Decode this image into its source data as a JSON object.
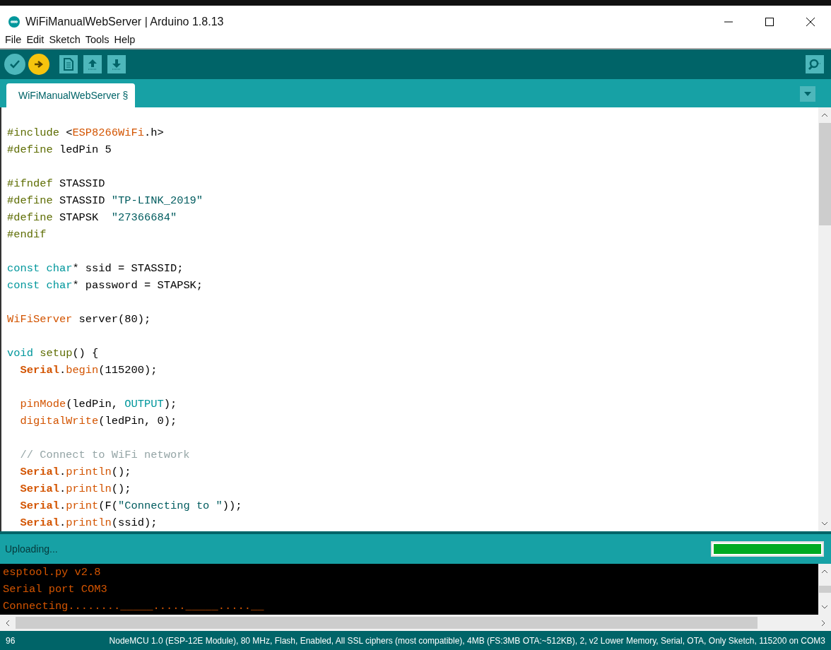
{
  "window": {
    "title": "WiFiManualWebServer | Arduino 1.8.13"
  },
  "menu": [
    "File",
    "Edit",
    "Sketch",
    "Tools",
    "Help"
  ],
  "tabs": [
    {
      "label": "WiFiManualWebServer §",
      "selected": true
    }
  ],
  "code_blocks": [
    {
      "lines": [
        [
          {
            "text": "#include",
            "kind": "directive"
          },
          {
            "text": " <",
            "kind": "plain"
          },
          {
            "text": "ESP8266WiFi",
            "kind": "type"
          },
          {
            "text": ".h>",
            "kind": "plain"
          }
        ],
        [
          {
            "text": "#define",
            "kind": "directive"
          },
          {
            "text": " ledPin 5",
            "kind": "plain"
          }
        ]
      ]
    },
    {
      "lines": [
        [
          {
            "text": "#ifndef",
            "kind": "directive"
          },
          {
            "text": " STASSID",
            "kind": "plain"
          }
        ],
        [
          {
            "text": "#define",
            "kind": "directive"
          },
          {
            "text": " STASSID ",
            "kind": "plain"
          },
          {
            "text": "\"TP-LINK_2019\"",
            "kind": "string"
          }
        ],
        [
          {
            "text": "#define",
            "kind": "directive"
          },
          {
            "text": " STAPSK  ",
            "kind": "plain"
          },
          {
            "text": "\"27366684\"",
            "kind": "string"
          }
        ],
        [
          {
            "text": "#endif",
            "kind": "directive"
          }
        ]
      ]
    },
    {
      "lines": [
        [
          {
            "text": "const ",
            "kind": "keyword"
          },
          {
            "text": "char",
            "kind": "keyword"
          },
          {
            "text": "* ssid = STASSID;",
            "kind": "plain"
          }
        ],
        [
          {
            "text": "const ",
            "kind": "keyword"
          },
          {
            "text": "char",
            "kind": "keyword"
          },
          {
            "text": "* password = STAPSK;",
            "kind": "plain"
          }
        ]
      ]
    },
    {
      "lines": [
        [
          {
            "text": "WiFiServer",
            "kind": "type"
          },
          {
            "text": " server(80);",
            "kind": "plain"
          }
        ]
      ]
    },
    {
      "lines": [
        [
          {
            "text": "void ",
            "kind": "keyword"
          },
          {
            "text": "setup",
            "kind": "directive"
          },
          {
            "text": "() {",
            "kind": "plain"
          }
        ],
        [
          {
            "text": "  Serial",
            "kind": "object"
          },
          {
            "text": ".",
            "kind": "plain"
          },
          {
            "text": "begin",
            "kind": "type"
          },
          {
            "text": "(115200);",
            "kind": "plain"
          }
        ]
      ]
    },
    {
      "lines": [
        [
          {
            "text": "  pinMode",
            "kind": "type"
          },
          {
            "text": "(ledPin, ",
            "kind": "plain"
          },
          {
            "text": "OUTPUT",
            "kind": "keyword"
          },
          {
            "text": ");",
            "kind": "plain"
          }
        ],
        [
          {
            "text": "  digitalWrite",
            "kind": "type"
          },
          {
            "text": "(ledPin, 0);",
            "kind": "plain"
          }
        ]
      ]
    },
    {
      "lines": [
        [
          {
            "text": "  // Connect to WiFi network",
            "kind": "comment"
          }
        ],
        [
          {
            "text": "  Serial",
            "kind": "object"
          },
          {
            "text": ".",
            "kind": "plain"
          },
          {
            "text": "println",
            "kind": "type"
          },
          {
            "text": "();",
            "kind": "plain"
          }
        ],
        [
          {
            "text": "  Serial",
            "kind": "object"
          },
          {
            "text": ".",
            "kind": "plain"
          },
          {
            "text": "println",
            "kind": "type"
          },
          {
            "text": "();",
            "kind": "plain"
          }
        ],
        [
          {
            "text": "  Serial",
            "kind": "object"
          },
          {
            "text": ".",
            "kind": "plain"
          },
          {
            "text": "print",
            "kind": "type"
          },
          {
            "text": "(F(",
            "kind": "plain"
          },
          {
            "text": "\"Connecting to \"",
            "kind": "string"
          },
          {
            "text": "));",
            "kind": "plain"
          }
        ],
        [
          {
            "text": "  Serial",
            "kind": "object"
          },
          {
            "text": ".",
            "kind": "plain"
          },
          {
            "text": "println",
            "kind": "type"
          },
          {
            "text": "(ssid);",
            "kind": "plain"
          }
        ]
      ]
    }
  ],
  "status": {
    "message": "Uploading...",
    "level": 1.0
  },
  "console_lines": [
    "esptool.py v2.8",
    "Serial port COM3",
    "Connecting........_____....._____.....__"
  ],
  "footer": {
    "line_number": "96",
    "board": "NodeMCU 1.0 (ESP-12E Module), 80 MHz, Flash, Enabled, All SSL ciphers (most compatible), 4MB (FS:3MB OTA:~512KB), 2, v2 Lower Memory, Serial, OTA, Only Sketch, 115200 on COM3"
  }
}
